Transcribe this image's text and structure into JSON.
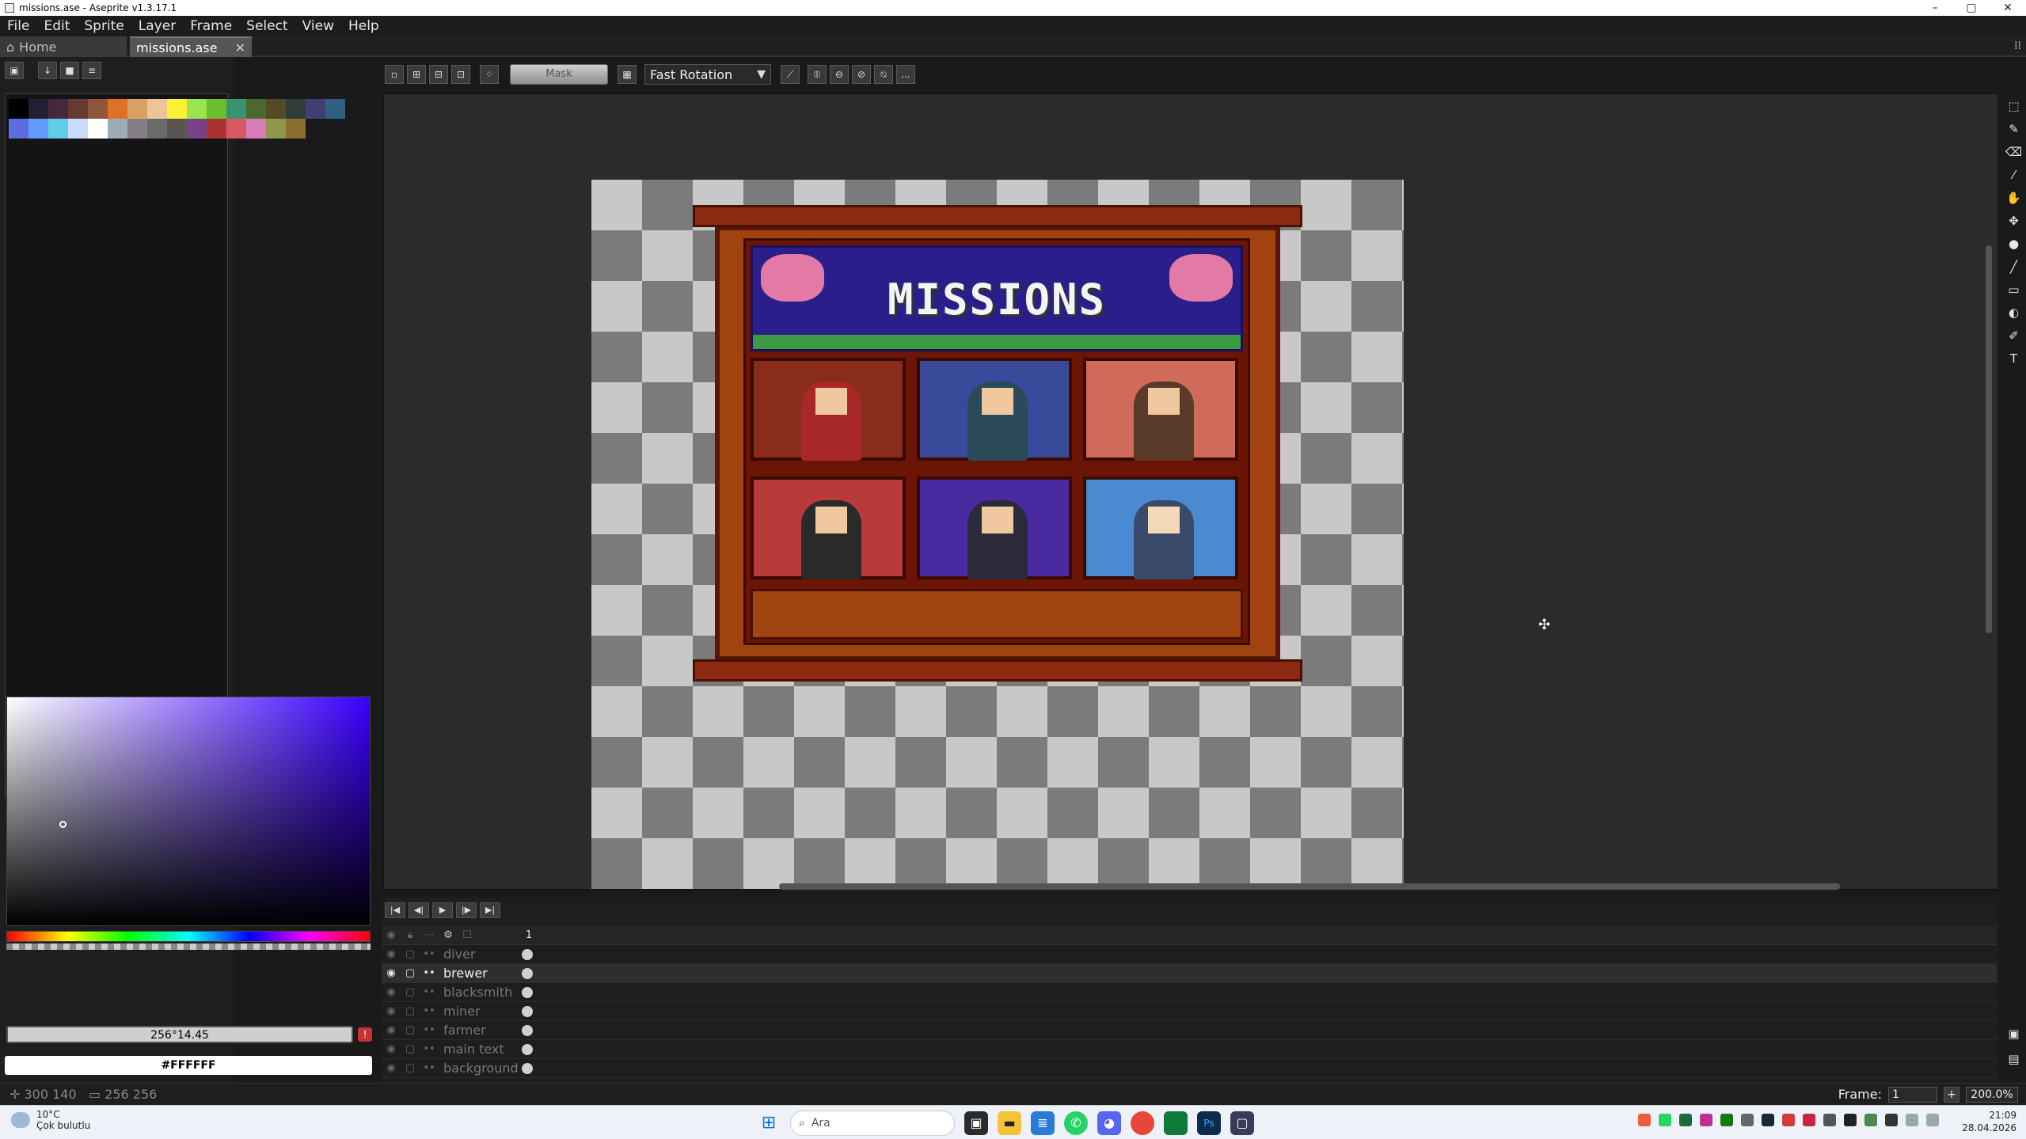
{
  "window": {
    "title": "missions.ase - Aseprite v1.3.17.1",
    "minimize": "–",
    "maximize": "▢",
    "close": "✕"
  },
  "menu": [
    "File",
    "Edit",
    "Sprite",
    "Layer",
    "Frame",
    "Select",
    "View",
    "Help"
  ],
  "tabs": [
    {
      "label": "Home",
      "icon": "home-icon"
    },
    {
      "label": "missions.ase",
      "close": "✕"
    }
  ],
  "palette": {
    "colors": [
      "#000000",
      "#222034",
      "#45283c",
      "#663931",
      "#8f563b",
      "#df7126",
      "#d9a066",
      "#eec39a",
      "#fbf236",
      "#99e550",
      "#6abe30",
      "#37946e",
      "#4b692f",
      "#524b24",
      "#323c39",
      "#3f3f74",
      "#306082",
      "#5b6ee1",
      "#639bff",
      "#5fcde4",
      "#cbdbfc",
      "#ffffff",
      "#9badb7",
      "#847e87",
      "#696a6a",
      "#595652",
      "#76428a",
      "#ac3232",
      "#d95763",
      "#d77bba",
      "#8f974a",
      "#8a6f30"
    ]
  },
  "color_picker": {
    "hsv": "256°14.45",
    "hex": "#FFFFFF",
    "warning": "!"
  },
  "context_bar": {
    "mask_label": "Mask",
    "rotation_algorithm": "Fast Rotation",
    "more": "..."
  },
  "sprite": {
    "banner_text": "MISSIONS"
  },
  "timeline": {
    "frame_header": "1",
    "layers": [
      {
        "name": "diver",
        "active": false
      },
      {
        "name": "brewer",
        "active": true
      },
      {
        "name": "blacksmith",
        "active": false
      },
      {
        "name": "miner",
        "active": false
      },
      {
        "name": "farmer",
        "active": false
      },
      {
        "name": "main text",
        "active": false
      },
      {
        "name": "background",
        "active": false
      }
    ]
  },
  "status": {
    "position": "300 140",
    "size": "256 256",
    "frame_label": "Frame:",
    "frame_value": "1",
    "zoom": "200.0%"
  },
  "taskbar": {
    "temperature": "10°C",
    "weather": "Çok bulutlu",
    "search_placeholder": "Ara",
    "time": "21:09",
    "date": "28.04.2026"
  }
}
